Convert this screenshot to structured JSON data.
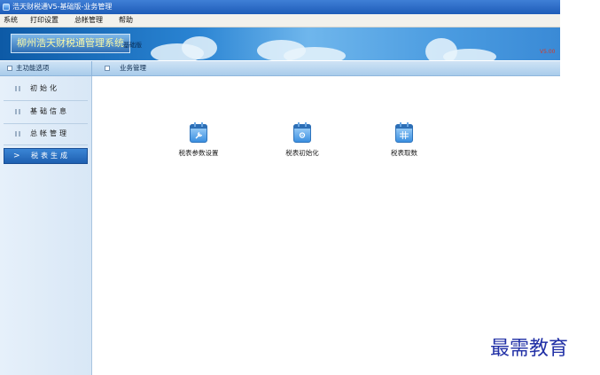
{
  "window": {
    "title": "浩天财税通V5-基础版-业务管理"
  },
  "menu": [
    "系统",
    "打印设置",
    "总帐管理",
    "帮助"
  ],
  "banner": {
    "brand_title": "柳州浩天财税通管理系统",
    "edition": "基础版",
    "version": "V5.00"
  },
  "left_header": "主功能选项",
  "main_header": "业务管理",
  "sidebar": {
    "items": [
      {
        "label": "初始化",
        "active": false
      },
      {
        "label": "基础信息",
        "active": false
      },
      {
        "label": "总帐管理",
        "active": false
      },
      {
        "label": "税表生成",
        "active": true
      }
    ]
  },
  "tiles": [
    {
      "label": "税表参数设置",
      "icon": "calendar-wrench-icon"
    },
    {
      "label": "税表初始化",
      "icon": "calendar-gear-icon"
    },
    {
      "label": "税表取数",
      "icon": "calendar-grid-icon"
    }
  ],
  "watermark": "最需教育",
  "colors": {
    "accent": "#1e5fb0",
    "sidebar_bg": "#e6f0fa",
    "watermark": "#2130a6"
  }
}
